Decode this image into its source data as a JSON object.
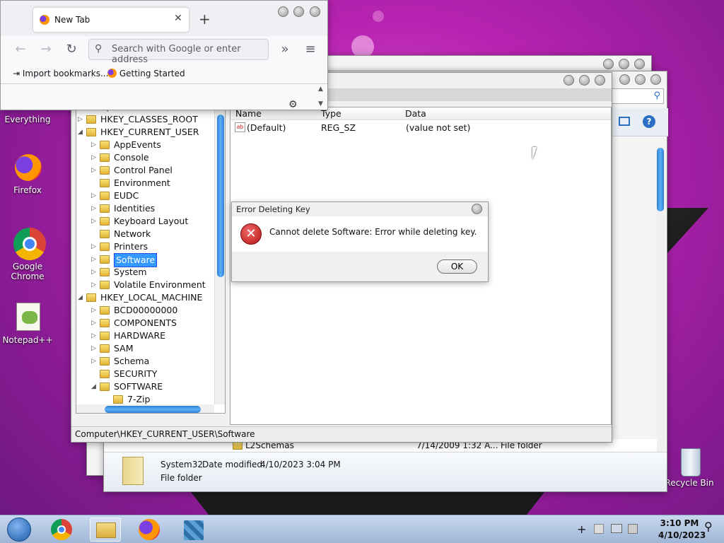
{
  "desktop": {
    "icons": [
      {
        "name": "everything",
        "label": "Everything"
      },
      {
        "name": "firefox",
        "label": "Firefox"
      },
      {
        "name": "google-chrome",
        "label": "Google Chrome"
      },
      {
        "name": "notepad-plus-plus",
        "label": "Notepad++"
      },
      {
        "name": "recycle-bin",
        "label": "Recycle Bin"
      }
    ]
  },
  "firefox": {
    "tab_title": "New Tab",
    "new_tab_icon": "+",
    "url_placeholder": "Search with Google or enter address",
    "bookmarks": [
      "Import bookmarks...",
      "Getting Started"
    ]
  },
  "regedit": {
    "tree_root": "Computer",
    "tree": [
      {
        "label": "HKEY_CLASSES_ROOT",
        "level": 0,
        "exp": "▷"
      },
      {
        "label": "HKEY_CURRENT_USER",
        "level": 0,
        "exp": "◢"
      },
      {
        "label": "AppEvents",
        "level": 1,
        "exp": "▷"
      },
      {
        "label": "Console",
        "level": 1,
        "exp": "▷"
      },
      {
        "label": "Control Panel",
        "level": 1,
        "exp": "▷"
      },
      {
        "label": "Environment",
        "level": 1,
        "exp": ""
      },
      {
        "label": "EUDC",
        "level": 1,
        "exp": "▷"
      },
      {
        "label": "Identities",
        "level": 1,
        "exp": "▷"
      },
      {
        "label": "Keyboard Layout",
        "level": 1,
        "exp": "▷"
      },
      {
        "label": "Network",
        "level": 1,
        "exp": ""
      },
      {
        "label": "Printers",
        "level": 1,
        "exp": "▷"
      },
      {
        "label": "Software",
        "level": 1,
        "exp": "▷",
        "selected": true
      },
      {
        "label": "System",
        "level": 1,
        "exp": "▷"
      },
      {
        "label": "Volatile Environment",
        "level": 1,
        "exp": "▷"
      },
      {
        "label": "HKEY_LOCAL_MACHINE",
        "level": 0,
        "exp": "◢"
      },
      {
        "label": "BCD00000000",
        "level": 1,
        "exp": "▷"
      },
      {
        "label": "COMPONENTS",
        "level": 1,
        "exp": "▷"
      },
      {
        "label": "HARDWARE",
        "level": 1,
        "exp": "▷"
      },
      {
        "label": "SAM",
        "level": 1,
        "exp": "▷"
      },
      {
        "label": "Schema",
        "level": 1,
        "exp": "▷"
      },
      {
        "label": "SECURITY",
        "level": 1,
        "exp": ""
      },
      {
        "label": "SOFTWARE",
        "level": 1,
        "exp": "◢"
      },
      {
        "label": "7-Zip",
        "level": 2,
        "exp": ""
      }
    ],
    "columns": [
      "Name",
      "Type",
      "Data"
    ],
    "values": [
      {
        "name": "(Default)",
        "type": "REG_SZ",
        "data": "(value not set)"
      }
    ],
    "status_path": "Computer\\HKEY_CURRENT_USER\\Software"
  },
  "dialog": {
    "title": "Error Deleting Key",
    "message": "Cannot delete Software:  Error while deleting key.",
    "ok_label": "OK"
  },
  "explorer": {
    "row_name": "L2Schemas",
    "row_date": "7/14/2009 1:32 A...",
    "row_type": "File folder",
    "details_name": "System32",
    "details_modified_label": "Date modified:",
    "details_modified": "4/10/2023 3:04 PM",
    "details_type": "File folder"
  },
  "taskbar": {
    "time": "3:10 PM",
    "date": "4/10/2023",
    "apps": [
      "start-orb",
      "chrome",
      "file-explorer",
      "firefox",
      "registry-editor"
    ]
  },
  "colors": {
    "desktop_bg": "#b622b0",
    "selection": "#3399ff",
    "error_red": "#cc1f1f"
  }
}
